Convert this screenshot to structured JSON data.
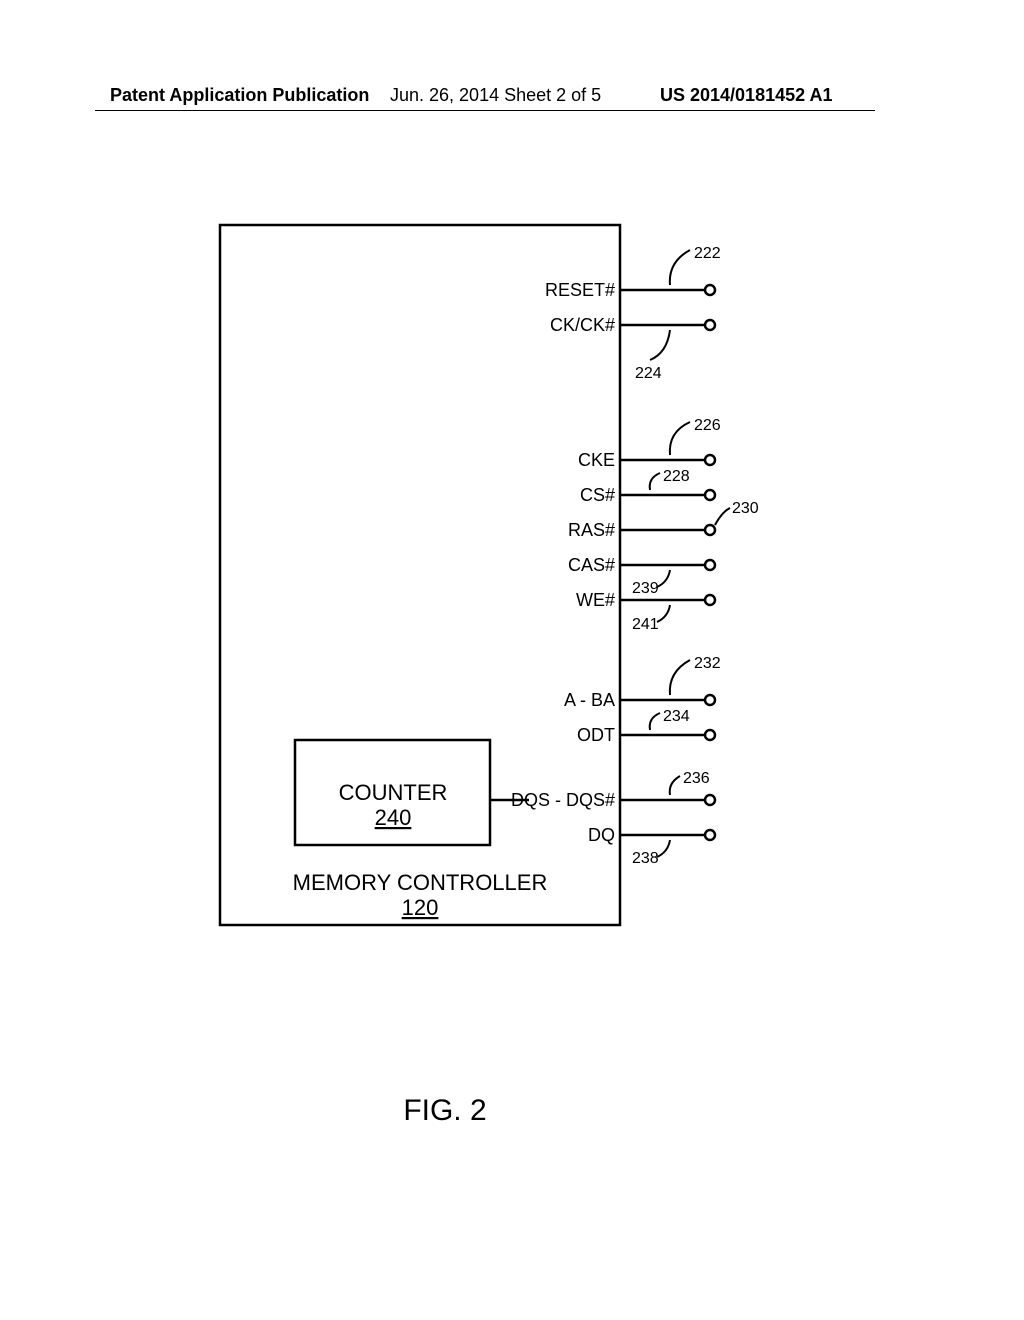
{
  "header": {
    "left": "Patent Application Publication",
    "center": "Jun. 26, 2014  Sheet 2 of 5",
    "right": "US 2014/0181452 A1"
  },
  "figure_label": "FIG. 2",
  "block": {
    "title": "MEMORY CONTROLLER",
    "ref": "120"
  },
  "counter": {
    "title": "COUNTER",
    "ref": "240"
  },
  "pins": [
    {
      "label": "RESET#",
      "ref": "222"
    },
    {
      "label": "CK/CK#",
      "ref": "224"
    },
    {
      "label": "CKE",
      "ref": "226"
    },
    {
      "label": "CS#",
      "ref": "228"
    },
    {
      "label": "RAS#",
      "ref": "230"
    },
    {
      "label": "CAS#",
      "ref": "239"
    },
    {
      "label": "WE#",
      "ref": "241"
    },
    {
      "label": "A - BA",
      "ref": "232"
    },
    {
      "label": "ODT",
      "ref": "234"
    },
    {
      "label": "DQS - DQS#",
      "ref": "236"
    },
    {
      "label": "DQ",
      "ref": "238"
    }
  ]
}
